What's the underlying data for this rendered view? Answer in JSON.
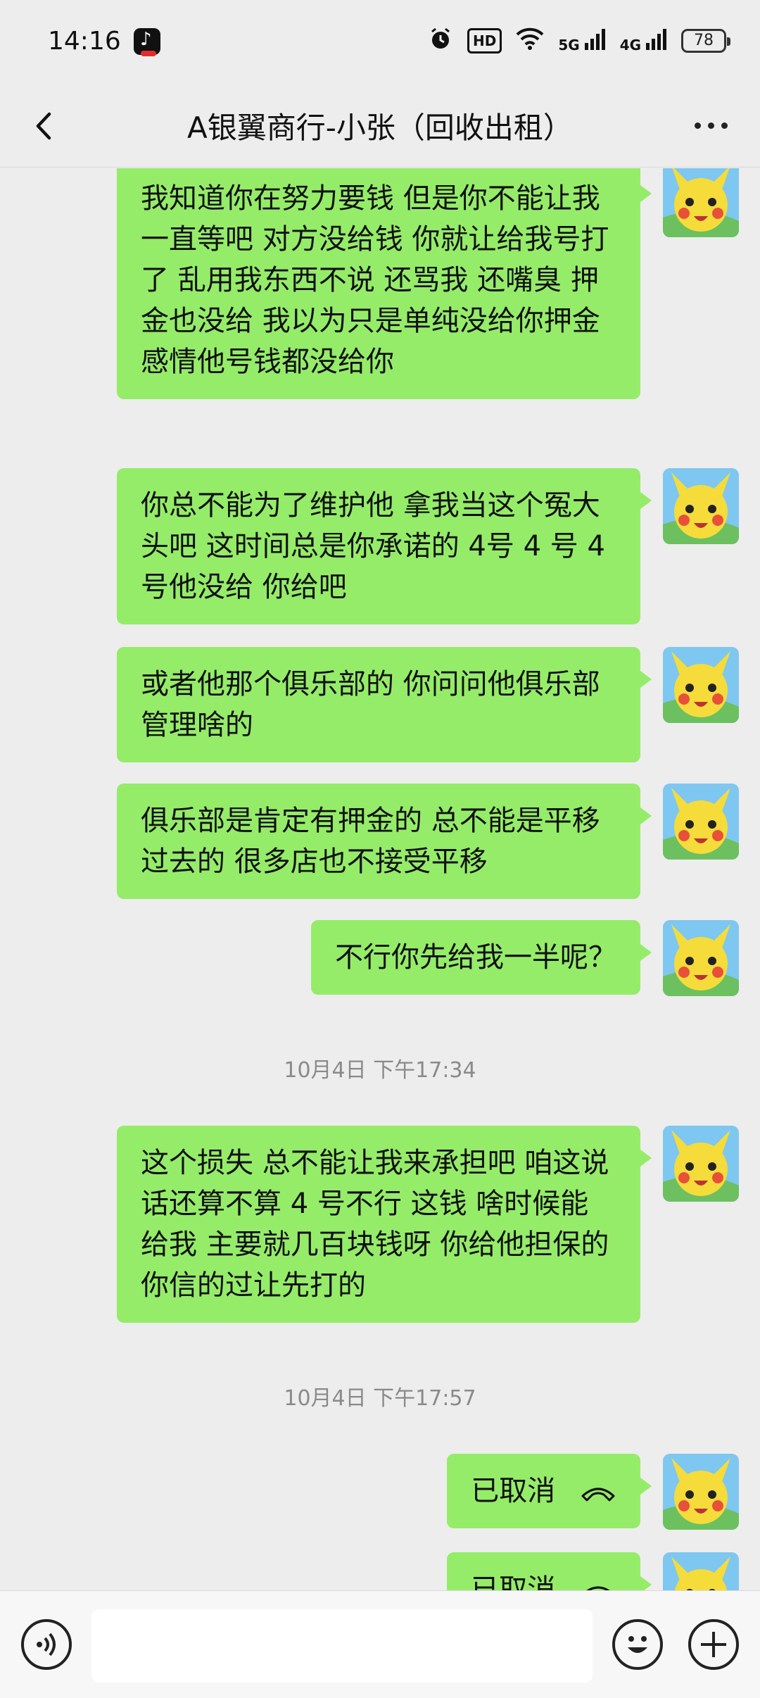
{
  "status_bar": {
    "time": "14:16",
    "app_icon": "tiktok-icon",
    "icons": [
      "alarm-icon",
      "hd-icon",
      "wifi-icon",
      "signal-5g-icon",
      "signal-4g-icon"
    ],
    "hd_label": "HD",
    "sig5g": "5G",
    "sig4g": "4G",
    "battery": "78"
  },
  "header": {
    "title": "A银翼商行-小张（回收出租）",
    "back_icon": "chevron-left-icon",
    "more_icon": "more-dots-icon"
  },
  "messages": [
    {
      "type": "sent",
      "text": "我知道你在努力要钱  但是你不能让我一直等吧  对方没给钱  你就让给我号打了  乱用我东西不说 还骂我 还嘴臭  押金也没给  我以为只是单纯没给你押金  感情他号钱都没给你"
    },
    {
      "type": "sent",
      "text": "你总不能为了维护他  拿我当这个冤大头吧  这时间总是你承诺的 4号 4 号  4 号他没给  你给吧"
    },
    {
      "type": "sent",
      "text": "或者他那个俱乐部的  你问问他俱乐部管理啥的"
    },
    {
      "type": "sent",
      "text": "俱乐部是肯定有押金的   总不能是平移过去的 很多店也不接受平移"
    },
    {
      "type": "sent",
      "text": "不行你先给我一半呢？"
    },
    {
      "type": "time",
      "text": "10月4日 下午17:34"
    },
    {
      "type": "sent",
      "text": "这个损失 总不能让我来承担吧  咱这说话还算不算  4 号不行 这钱 啥时候能给我  主要就几百块钱呀  你给他担保的 你信的过让先打的"
    },
    {
      "type": "time",
      "text": "10月4日 下午17:57"
    },
    {
      "type": "call",
      "text": "已取消"
    },
    {
      "type": "call",
      "text": "已取消"
    }
  ],
  "input_bar": {
    "voice_icon": "voice-icon",
    "input_value": "",
    "emoji_icon": "emoji-icon",
    "plus_icon": "plus-icon"
  },
  "colors": {
    "bubble": "#95ec69",
    "background": "#ededed",
    "time_label": "#8a8a8a"
  }
}
